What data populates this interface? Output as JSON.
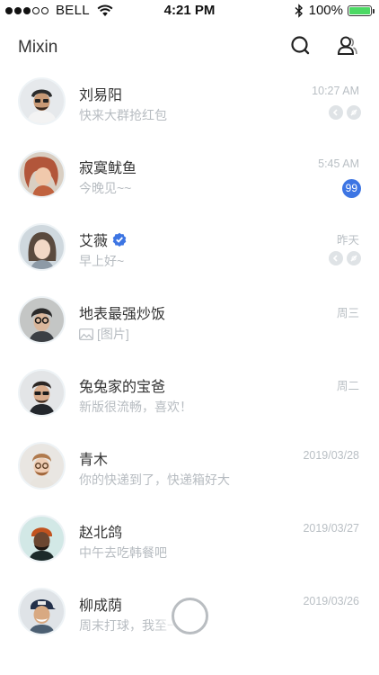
{
  "status_bar": {
    "carrier": "BELL",
    "time": "4:21 PM",
    "battery": "100%",
    "signal_bars_filled": 3,
    "signal_bars_total": 5
  },
  "header": {
    "title": "Mixin",
    "search_icon": "search-icon",
    "contacts_icon": "contacts-icon"
  },
  "colors": {
    "badge": "#3d75e3",
    "verified": "#3d75e3",
    "battery": "#4cd964"
  },
  "chats": [
    {
      "name": "刘易阳",
      "time": "10:27 AM",
      "preview": "快来大群抢红包",
      "muted": true
    },
    {
      "name": "寂寞鱿鱼",
      "time": "5:45 AM",
      "preview": "今晚见~~",
      "unread": "99"
    },
    {
      "name": "艾薇",
      "time": "昨天",
      "preview": "早上好~",
      "verified": true,
      "muted": true
    },
    {
      "name": "地表最强炒饭",
      "time": "周三",
      "preview": "[图片]",
      "image": true
    },
    {
      "name": "兔兔家的宝爸",
      "time": "周二",
      "preview": "新版很流畅，喜欢！"
    },
    {
      "name": "青木",
      "time": "2019/03/28",
      "preview": "你的快递到了，快递箱好大"
    },
    {
      "name": "赵北鸽",
      "time": "2019/03/27",
      "preview": "中午去吃韩餐吧"
    },
    {
      "name": "柳成荫",
      "time": "2019/03/26",
      "preview": "周末打球，我至一会了"
    }
  ]
}
